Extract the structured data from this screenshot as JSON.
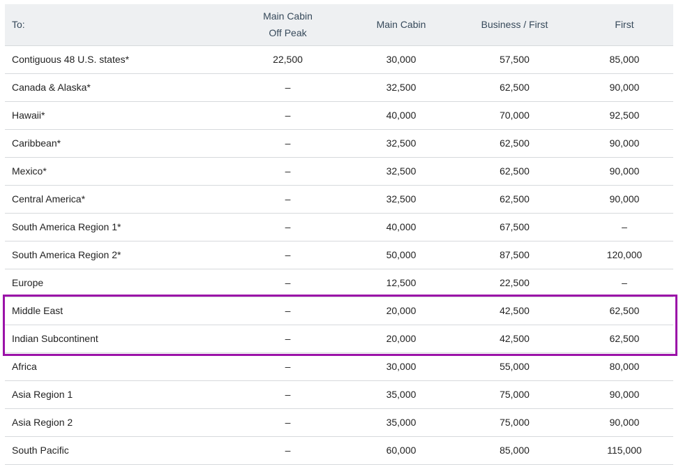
{
  "table": {
    "headers": [
      {
        "key": "to",
        "lines": [
          "To:"
        ]
      },
      {
        "key": "main_cabin_off_peak",
        "lines": [
          "Main Cabin",
          "Off Peak"
        ]
      },
      {
        "key": "main_cabin",
        "lines": [
          "Main Cabin"
        ]
      },
      {
        "key": "business_first",
        "lines": [
          "Business / First"
        ]
      },
      {
        "key": "first",
        "lines": [
          "First"
        ]
      }
    ],
    "rows": [
      {
        "destination": "Contiguous 48 U.S. states*",
        "off_peak": "22,500",
        "main_cabin": "30,000",
        "business_first": "57,500",
        "first": "85,000"
      },
      {
        "destination": "Canada & Alaska*",
        "off_peak": "–",
        "main_cabin": "32,500",
        "business_first": "62,500",
        "first": "90,000"
      },
      {
        "destination": "Hawaii*",
        "off_peak": "–",
        "main_cabin": "40,000",
        "business_first": "70,000",
        "first": "92,500"
      },
      {
        "destination": "Caribbean*",
        "off_peak": "–",
        "main_cabin": "32,500",
        "business_first": "62,500",
        "first": "90,000"
      },
      {
        "destination": "Mexico*",
        "off_peak": "–",
        "main_cabin": "32,500",
        "business_first": "62,500",
        "first": "90,000"
      },
      {
        "destination": "Central America*",
        "off_peak": "–",
        "main_cabin": "32,500",
        "business_first": "62,500",
        "first": "90,000"
      },
      {
        "destination": "South America Region 1*",
        "off_peak": "–",
        "main_cabin": "40,000",
        "business_first": "67,500",
        "first": "–"
      },
      {
        "destination": "South America Region 2*",
        "off_peak": "–",
        "main_cabin": "50,000",
        "business_first": "87,500",
        "first": "120,000"
      },
      {
        "destination": "Europe",
        "off_peak": "–",
        "main_cabin": "12,500",
        "business_first": "22,500",
        "first": "–"
      },
      {
        "destination": "Middle East",
        "off_peak": "–",
        "main_cabin": "20,000",
        "business_first": "42,500",
        "first": "62,500"
      },
      {
        "destination": "Indian Subcontinent",
        "off_peak": "–",
        "main_cabin": "20,000",
        "business_first": "42,500",
        "first": "62,500"
      },
      {
        "destination": "Africa",
        "off_peak": "–",
        "main_cabin": "30,000",
        "business_first": "55,000",
        "first": "80,000"
      },
      {
        "destination": "Asia Region 1",
        "off_peak": "–",
        "main_cabin": "35,000",
        "business_first": "75,000",
        "first": "90,000"
      },
      {
        "destination": "Asia Region 2",
        "off_peak": "–",
        "main_cabin": "35,000",
        "business_first": "75,000",
        "first": "90,000"
      },
      {
        "destination": "South Pacific",
        "off_peak": "–",
        "main_cabin": "60,000",
        "business_first": "85,000",
        "first": "115,000"
      }
    ]
  },
  "colors": {
    "header_background": "#eef0f2",
    "header_text": "#36495a",
    "body_text": "#222222",
    "row_divider": "#d6d9dc",
    "highlight_border": "#9b12a8"
  }
}
